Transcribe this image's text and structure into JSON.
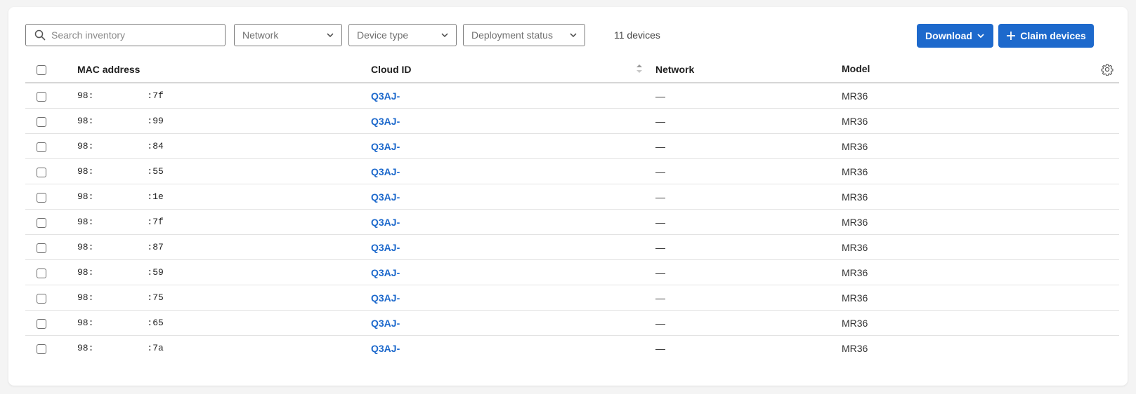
{
  "toolbar": {
    "search_placeholder": "Search inventory",
    "filters": [
      {
        "label": "Network"
      },
      {
        "label": "Device type"
      },
      {
        "label": "Deployment status"
      }
    ],
    "device_count": "11 devices",
    "download_label": "Download",
    "claim_label": "Claim devices"
  },
  "table": {
    "headers": {
      "mac": "MAC address",
      "cloud_id": "Cloud ID",
      "network": "Network",
      "model": "Model"
    },
    "rows": [
      {
        "mac_prefix": "98:",
        "mac_suffix": ":7f",
        "cloud_id": "Q3AJ-",
        "network": "—",
        "model": "MR36"
      },
      {
        "mac_prefix": "98:",
        "mac_suffix": ":99",
        "cloud_id": "Q3AJ-",
        "network": "—",
        "model": "MR36"
      },
      {
        "mac_prefix": "98:",
        "mac_suffix": ":84",
        "cloud_id": "Q3AJ-",
        "network": "—",
        "model": "MR36"
      },
      {
        "mac_prefix": "98:",
        "mac_suffix": ":55",
        "cloud_id": "Q3AJ-",
        "network": "—",
        "model": "MR36"
      },
      {
        "mac_prefix": "98:",
        "mac_suffix": ":1e",
        "cloud_id": "Q3AJ-",
        "network": "—",
        "model": "MR36"
      },
      {
        "mac_prefix": "98:",
        "mac_suffix": ":7f",
        "cloud_id": "Q3AJ-",
        "network": "—",
        "model": "MR36"
      },
      {
        "mac_prefix": "98:",
        "mac_suffix": ":87",
        "cloud_id": "Q3AJ-",
        "network": "—",
        "model": "MR36"
      },
      {
        "mac_prefix": "98:",
        "mac_suffix": ":59",
        "cloud_id": "Q3AJ-",
        "network": "—",
        "model": "MR36"
      },
      {
        "mac_prefix": "98:",
        "mac_suffix": ":75",
        "cloud_id": "Q3AJ-",
        "network": "—",
        "model": "MR36"
      },
      {
        "mac_prefix": "98:",
        "mac_suffix": ":65",
        "cloud_id": "Q3AJ-",
        "network": "—",
        "model": "MR36"
      },
      {
        "mac_prefix": "98:",
        "mac_suffix": ":7a",
        "cloud_id": "Q3AJ-",
        "network": "—",
        "model": "MR36"
      }
    ]
  },
  "icons": {
    "search": "search-icon",
    "chevron": "chevron-down-icon",
    "plus": "plus-icon",
    "sort": "sort-icon",
    "settings": "gear-icon"
  },
  "colors": {
    "accent": "#1d69cc",
    "background": "#f4f4f4",
    "card": "#ffffff"
  }
}
